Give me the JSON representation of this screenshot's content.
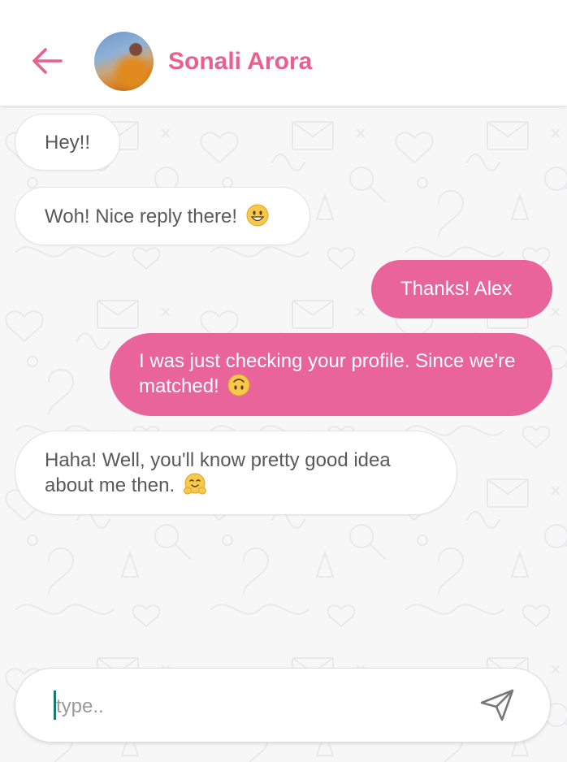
{
  "header": {
    "back_icon": "arrow-left-icon",
    "contact_name": "Sonali Arora",
    "avatar": "contact-avatar-photo"
  },
  "messages": [
    {
      "direction": "incoming",
      "text": "Hey!!"
    },
    {
      "direction": "incoming",
      "text": "Woh! Nice reply there!",
      "emoji": "grinning-face-emoji"
    },
    {
      "direction": "outgoing",
      "text": "Thanks! Alex"
    },
    {
      "direction": "outgoing",
      "text": "I was just checking your profile. Since we're matched!",
      "emoji": "upside-down-face-emoji"
    },
    {
      "direction": "incoming",
      "text": "Haha! Well, you'll know pretty good idea about me then.",
      "emoji": "hugging-face-emoji"
    }
  ],
  "composer": {
    "placeholder": "type..",
    "value": "",
    "send_icon": "send-icon"
  },
  "colors": {
    "accent": "#e8649a",
    "name": "#e8608f",
    "incoming_bubble": "#ffffff",
    "incoming_text": "#595959",
    "outgoing_text": "#ffffff",
    "background": "#f7f7f8",
    "caret": "#167a6e"
  }
}
